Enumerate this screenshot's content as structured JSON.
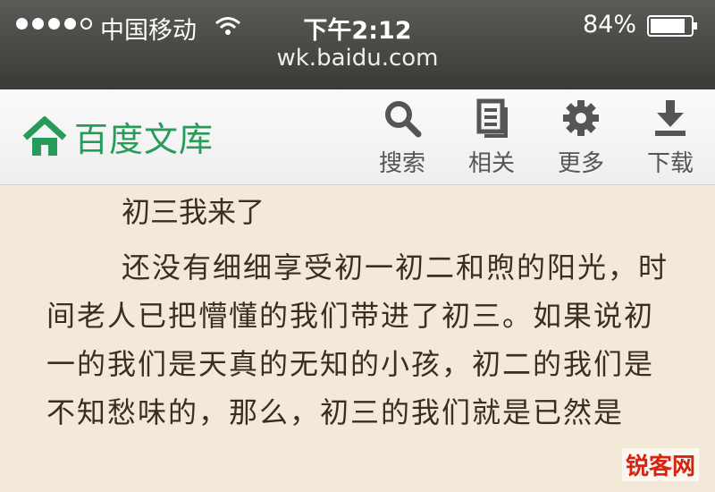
{
  "status_bar": {
    "carrier": "中国移动",
    "time": "下午2:12",
    "battery": "84%"
  },
  "browser": {
    "url": "wk.baidu.com"
  },
  "nav": {
    "brand": "百度文库",
    "tools": [
      {
        "label": "搜索",
        "icon": "search-icon"
      },
      {
        "label": "相关",
        "icon": "document-icon"
      },
      {
        "label": "更多",
        "icon": "gear-icon"
      },
      {
        "label": "下载",
        "icon": "download-icon"
      }
    ]
  },
  "article": {
    "title": "初三我来了",
    "body": "还没有细细享受初一初二和煦的阳光，时间老人已把懵懂的我们带进了初三。如果说初一的我们是天真的无知的小孩，初二的我们是不知愁味的，那么，初三的我们就是已然是"
  },
  "watermark": "锐客网",
  "colors": {
    "brand_green": "#279c5a",
    "page_bg": "#f2e9d9",
    "text": "#3a2e22"
  }
}
